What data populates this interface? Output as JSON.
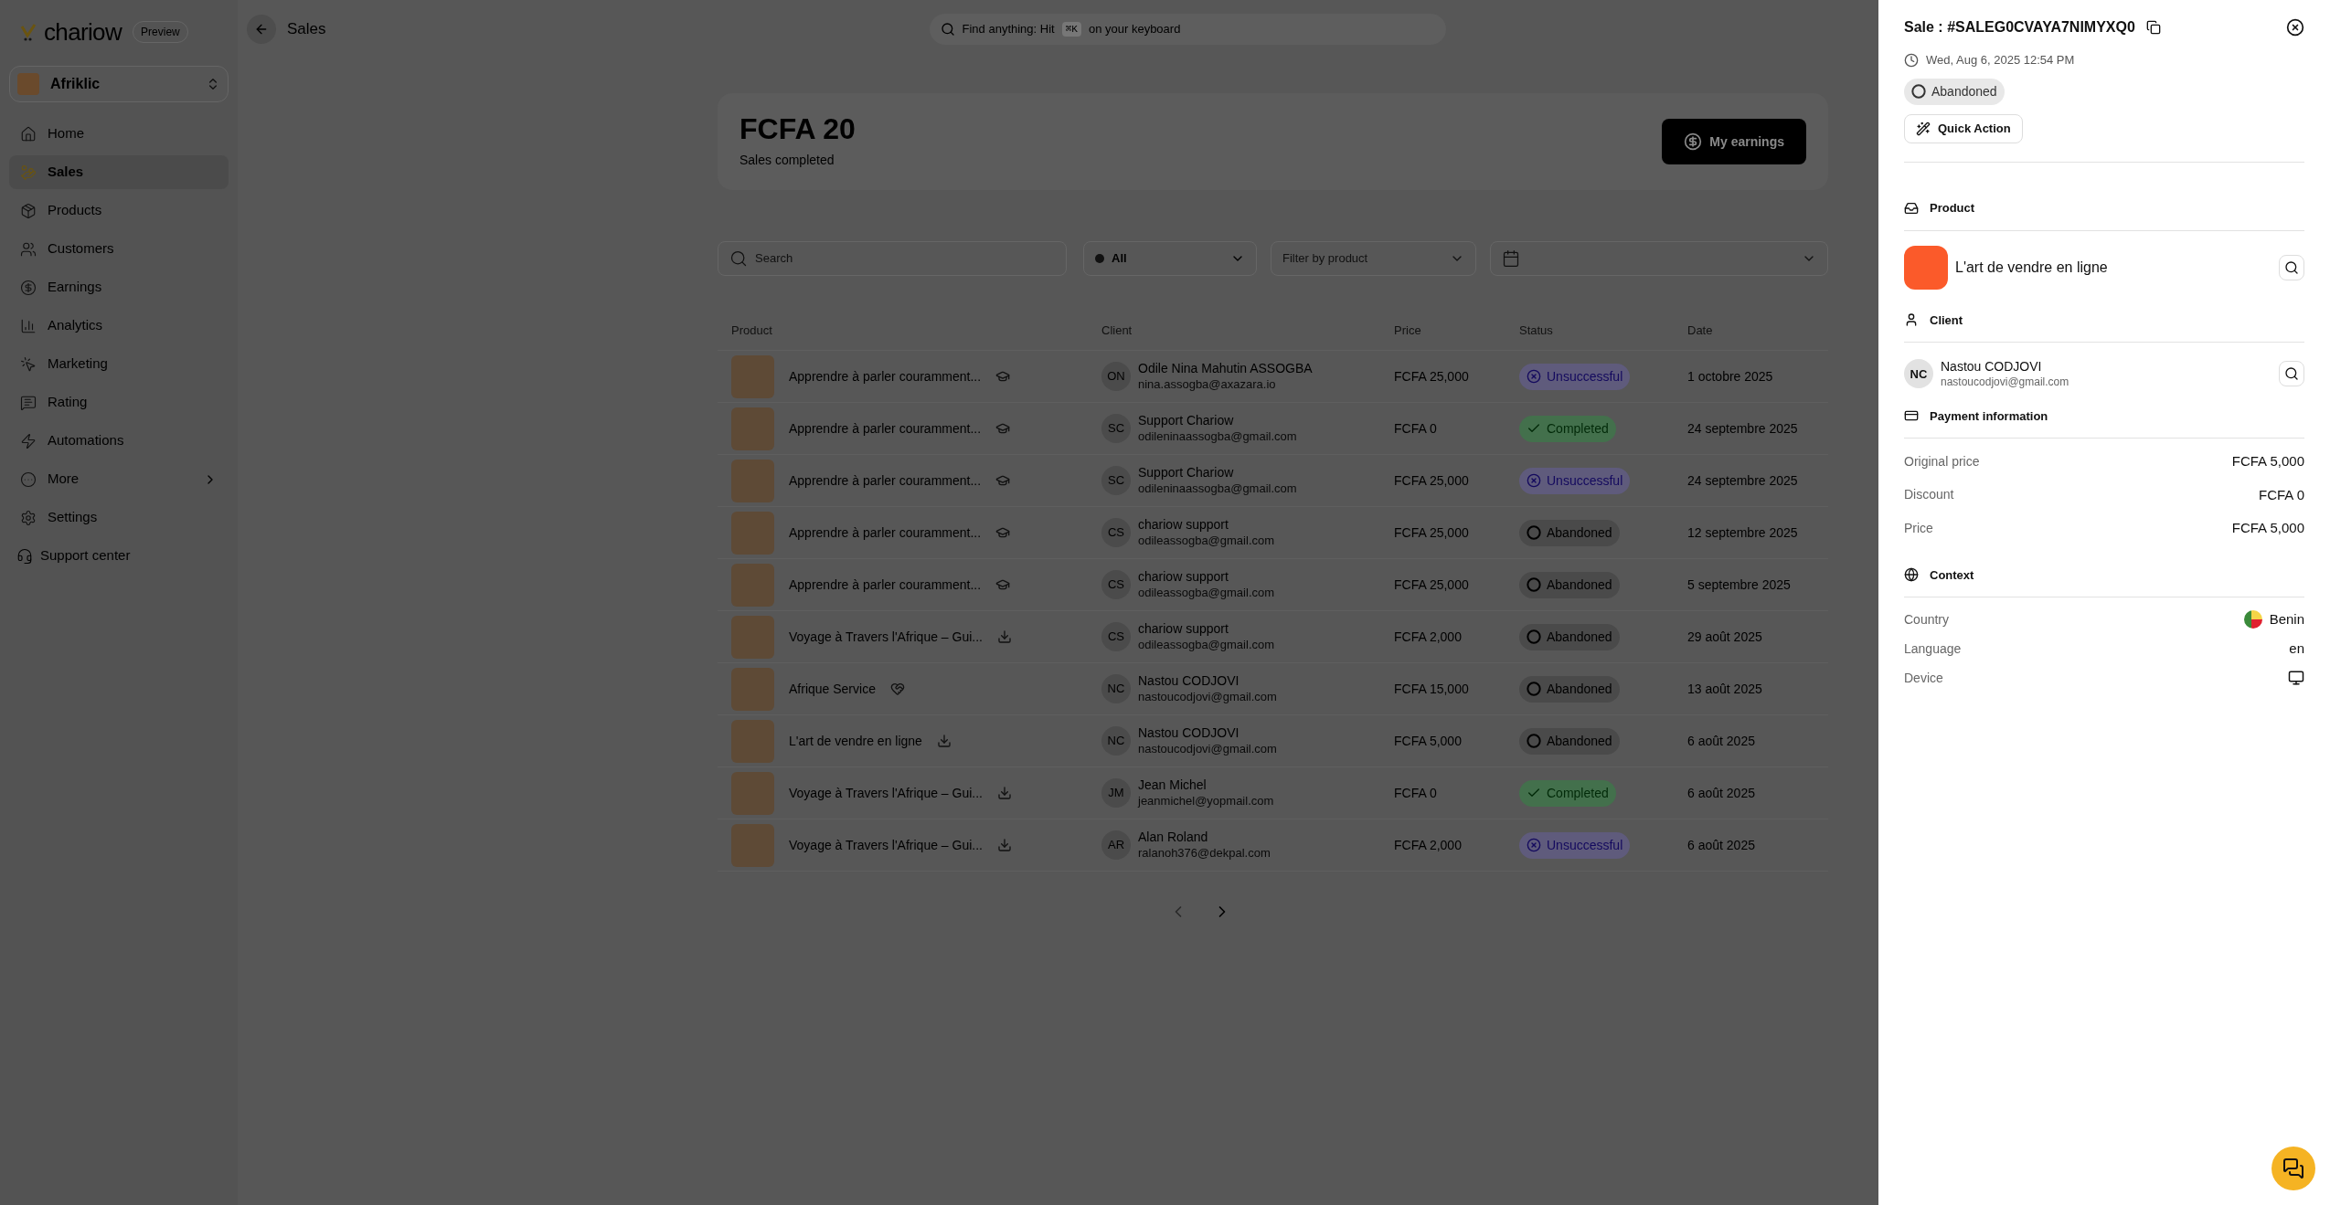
{
  "brand": {
    "name": "chariow",
    "badge": "Preview"
  },
  "workspace": {
    "name": "Afriklic"
  },
  "sidebar": {
    "items": [
      {
        "label": "Home",
        "selected": false,
        "submenu": false
      },
      {
        "label": "Sales",
        "selected": true,
        "submenu": false
      },
      {
        "label": "Products",
        "selected": false,
        "submenu": false
      },
      {
        "label": "Customers",
        "selected": false,
        "submenu": false
      },
      {
        "label": "Earnings",
        "selected": false,
        "submenu": false
      },
      {
        "label": "Analytics",
        "selected": false,
        "submenu": false
      },
      {
        "label": "Marketing",
        "selected": false,
        "submenu": false
      },
      {
        "label": "Rating",
        "selected": false,
        "submenu": false
      },
      {
        "label": "Automations",
        "selected": false,
        "submenu": false
      },
      {
        "label": "More",
        "selected": false,
        "submenu": true
      },
      {
        "label": "Settings",
        "selected": false,
        "submenu": false
      }
    ],
    "support": "Support center"
  },
  "topbar": {
    "title": "Sales",
    "search": {
      "prefix": "Find anything: Hit",
      "key": "⌘K",
      "suffix": "on your keyboard"
    }
  },
  "summary": {
    "amount": "FCFA 20",
    "caption": "Sales completed",
    "button": "My earnings"
  },
  "filters": {
    "search": {
      "placeholder": "Search"
    },
    "status": {
      "value": "All"
    },
    "product": {
      "placeholder": "Filter by product"
    }
  },
  "table": {
    "columns": [
      "Product",
      "Client",
      "Price",
      "Status",
      "Date"
    ],
    "rows": [
      {
        "product": {
          "name": "Apprendre à parler couramment...",
          "kind": "course"
        },
        "initials": "ON",
        "name": "Odile Nina Mahutin ASSOGBA",
        "email": "nina.assogba@axazara.io",
        "price": "FCFA 25,000",
        "status": {
          "text": "Unsuccessful",
          "kind": "unsuccessful"
        },
        "date": "1 octobre 2025"
      },
      {
        "product": {
          "name": "Apprendre à parler couramment...",
          "kind": "course"
        },
        "initials": "SC",
        "name": "Support Chariow",
        "email": "odileninaassogba@gmail.com",
        "price": "FCFA 0",
        "status": {
          "text": "Completed",
          "kind": "completed"
        },
        "date": "24 septembre 2025"
      },
      {
        "product": {
          "name": "Apprendre à parler couramment...",
          "kind": "course"
        },
        "initials": "SC",
        "name": "Support Chariow",
        "email": "odileninaassogba@gmail.com",
        "price": "FCFA 25,000",
        "status": {
          "text": "Unsuccessful",
          "kind": "unsuccessful"
        },
        "date": "24 septembre 2025"
      },
      {
        "product": {
          "name": "Apprendre à parler couramment...",
          "kind": "course"
        },
        "initials": "CS",
        "name": "chariow support",
        "email": "odileassogba@gmail.com",
        "price": "FCFA 25,000",
        "status": {
          "text": "Abandoned",
          "kind": "abandoned"
        },
        "date": "12 septembre 2025"
      },
      {
        "product": {
          "name": "Apprendre à parler couramment...",
          "kind": "course"
        },
        "initials": "CS",
        "name": "chariow support",
        "email": "odileassogba@gmail.com",
        "price": "FCFA 25,000",
        "status": {
          "text": "Abandoned",
          "kind": "abandoned"
        },
        "date": "5 septembre 2025"
      },
      {
        "product": {
          "name": "Voyage à Travers l'Afrique – Gui...",
          "kind": "download"
        },
        "initials": "CS",
        "name": "chariow support",
        "email": "odileassogba@gmail.com",
        "price": "FCFA 2,000",
        "status": {
          "text": "Abandoned",
          "kind": "abandoned"
        },
        "date": "29 août 2025"
      },
      {
        "product": {
          "name": "Afrique Service",
          "kind": "service"
        },
        "initials": "NC",
        "name": "Nastou CODJOVI",
        "email": "nastoucodjovi@gmail.com",
        "price": "FCFA 15,000",
        "status": {
          "text": "Abandoned",
          "kind": "abandoned"
        },
        "date": "13 août 2025"
      },
      {
        "product": {
          "name": "L'art de vendre en ligne",
          "kind": "download"
        },
        "initials": "NC",
        "name": "Nastou CODJOVI",
        "email": "nastoucodjovi@gmail.com",
        "price": "FCFA 5,000",
        "status": {
          "text": "Abandoned",
          "kind": "abandoned"
        },
        "date": "6 août 2025"
      },
      {
        "product": {
          "name": "Voyage à Travers l'Afrique – Gui...",
          "kind": "download"
        },
        "initials": "JM",
        "name": "Jean Michel",
        "email": "jeanmichel@yopmail.com",
        "price": "FCFA 0",
        "status": {
          "text": "Completed",
          "kind": "completed"
        },
        "date": "6 août 2025"
      },
      {
        "product": {
          "name": "Voyage à Travers l'Afrique – Gui...",
          "kind": "download"
        },
        "initials": "AR",
        "name": "Alan Roland",
        "email": "ralanoh376@dekpal.com",
        "price": "FCFA 2,000",
        "status": {
          "text": "Unsuccessful",
          "kind": "unsuccessful"
        },
        "date": "6 août 2025"
      }
    ]
  },
  "pagination": {
    "previous": {
      "disabled": true
    },
    "next": {
      "disabled": false
    }
  },
  "detail": {
    "title": "Sale : #SALEG0CVAYA7NIMYXQ0",
    "datetime": "Wed, Aug 6, 2025 12:54 PM",
    "status": {
      "text": "Abandoned",
      "kind": "abandoned"
    },
    "quick_action": "Quick Action",
    "product_heading": "Product",
    "product_name": "L'art de vendre en ligne",
    "client_heading": "Client",
    "client_initials": "NC",
    "client_name": "Nastou CODJOVI",
    "client_email": "nastoucodjovi@gmail.com",
    "payment_heading": "Payment information",
    "payment_rows": [
      {
        "label": "Original price",
        "value": "FCFA 5,000"
      },
      {
        "label": "Discount",
        "value": "FCFA 0"
      },
      {
        "label": "Price",
        "value": "FCFA 5,000"
      }
    ],
    "context_heading": "Context",
    "context_rows": [
      {
        "label": "Country",
        "kind": "country",
        "value": "Benin"
      },
      {
        "label": "Language",
        "kind": "text",
        "value": "en"
      },
      {
        "label": "Device",
        "kind": "device"
      }
    ]
  }
}
